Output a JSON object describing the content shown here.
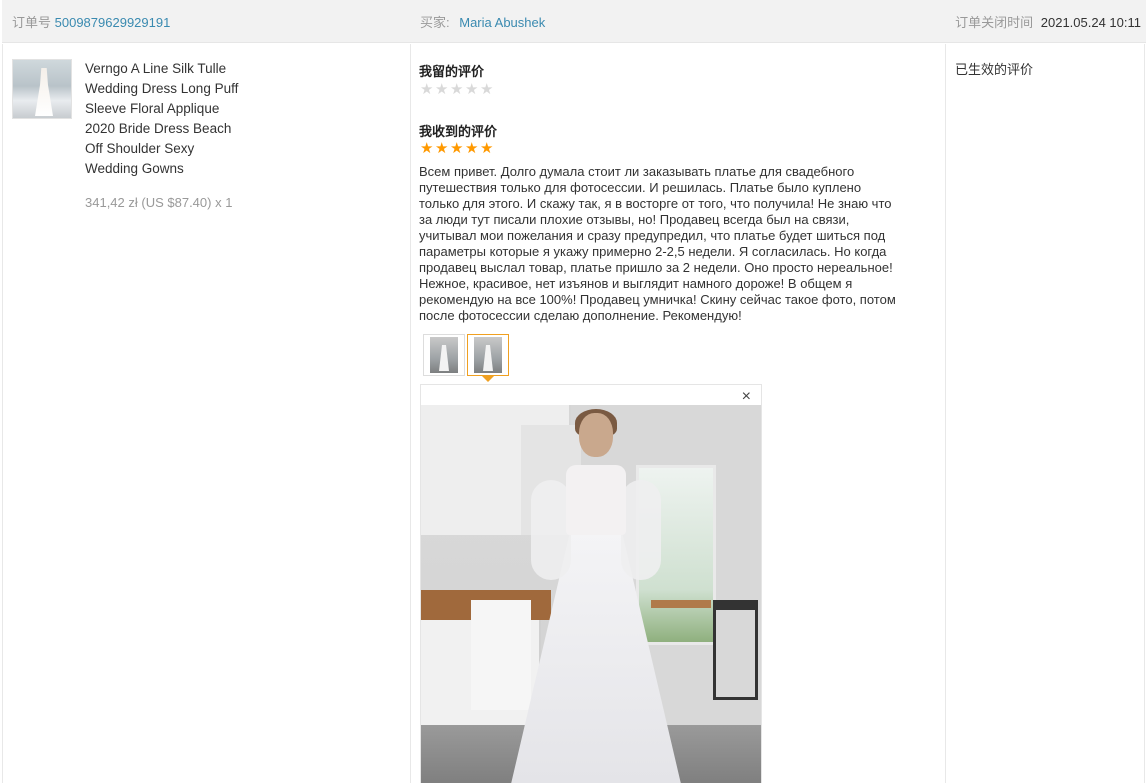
{
  "header": {
    "order_label": "订单号",
    "order_number": "5009879629929191",
    "buyer_label": "买家:",
    "buyer_name": "Maria Abushek",
    "closed_label": "订单关闭时间",
    "closed_time": "2021.05.24 10:11"
  },
  "product": {
    "thumbnail_icon": "wedding-dress-photo",
    "title_lines": [
      "Verngo A Line Silk Tulle",
      "Wedding Dress Long Puff",
      "Sleeve Floral Applique",
      "2020 Bride Dress Beach",
      "Off Shoulder Sexy",
      "Wedding Gowns"
    ],
    "price": "341,42 zł (US $87.40) x 1"
  },
  "my_review": {
    "title": "我留的评价",
    "rating": 0,
    "max_rating": 5
  },
  "received_review": {
    "title": "我收到的评价",
    "rating": 5,
    "max_rating": 5,
    "text_lines": [
      "Всем привет. Долго думала стоит ли заказывать платье для свадебного",
      "путешествия только для фотосессии. И решилась. Платье было куплено",
      "только для этого. И скажу так, я в восторге от того, что получила! Не знаю что",
      "за люди тут писали плохие отзывы, но! Продавец всегда был на связи,",
      "учитывал мои пожелания и сразу предупредил, что платье будет шиться под",
      "параметры которые я укажу примерно 2-2,5 недели. Я согласилась. Но когда",
      "продавец выслал товар, платье пришло за 2 недели. Оно просто нереальное!",
      "Нежное, красивое, нет изъянов и выглядит намного дороже! В общем я",
      "рекомендую на все 100%! Продавец умничка! Скину сейчас такое фото, потом",
      "после фотосессии сделаю дополнение. Рекомендую!"
    ],
    "photos_selected_index": 1,
    "close_icon": "×"
  },
  "effective_review": {
    "title": "已生效的评价"
  },
  "colors": {
    "star_full": "#ff9900",
    "star_empty": "#d9d9d9",
    "link": "#3a8ab0",
    "selected_border": "#f0a020"
  }
}
